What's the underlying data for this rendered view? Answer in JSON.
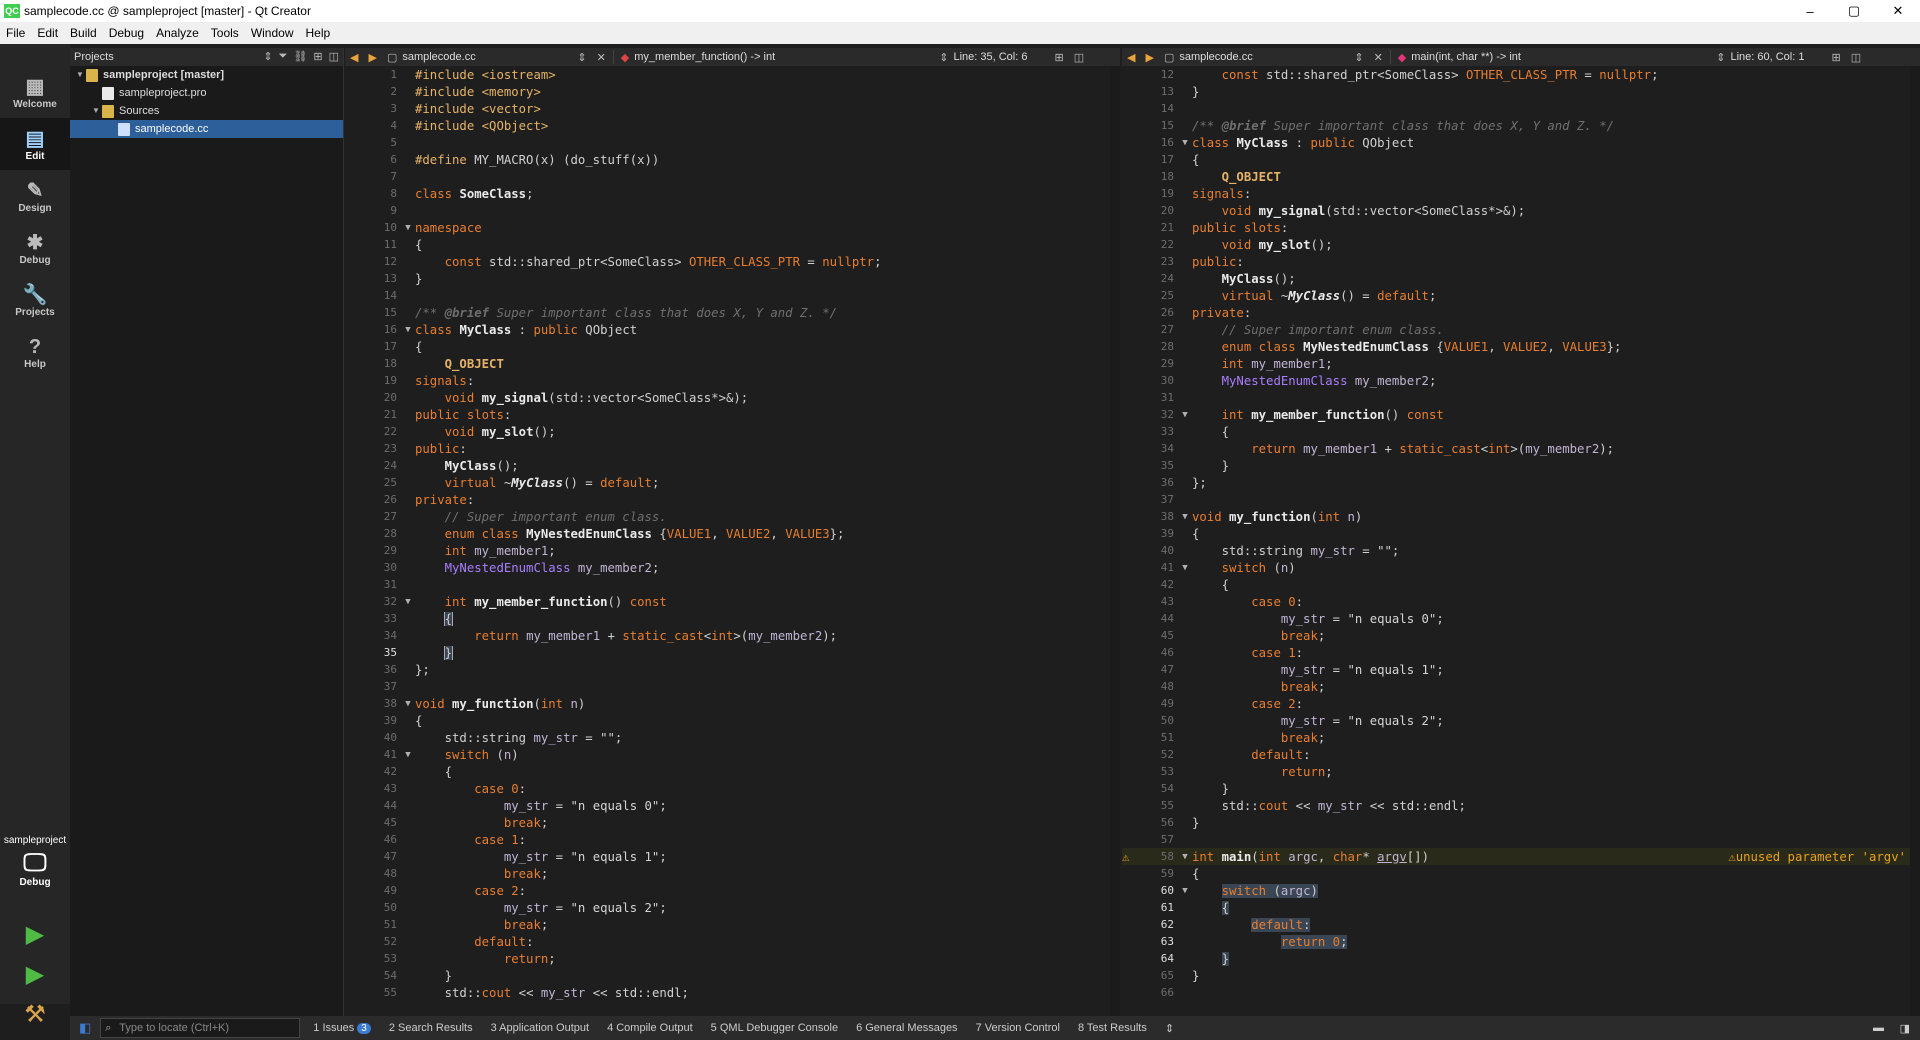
{
  "window": {
    "title": "samplecode.cc @ sampleproject [master] - Qt Creator",
    "min": "–",
    "max": "▢",
    "close": "✕",
    "logo": "QC"
  },
  "menu": [
    "File",
    "Edit",
    "Build",
    "Debug",
    "Analyze",
    "Tools",
    "Window",
    "Help"
  ],
  "modes": [
    {
      "label": "Welcome",
      "icon": "▦"
    },
    {
      "label": "Edit",
      "icon": "▤"
    },
    {
      "label": "Design",
      "icon": "✎"
    },
    {
      "label": "Debug",
      "icon": "✱"
    },
    {
      "label": "Projects",
      "icon": "🔧"
    },
    {
      "label": "Help",
      "icon": "?"
    }
  ],
  "kit": {
    "project": "sampleproject",
    "mode": "Debug"
  },
  "projects_pane": {
    "title": "Projects",
    "tree": [
      {
        "label": "sampleproject [master]",
        "level": 0,
        "arrow": "▼",
        "icon": "folder",
        "bold": true
      },
      {
        "label": "sampleproject.pro",
        "level": 1,
        "arrow": "",
        "icon": "file"
      },
      {
        "label": "Sources",
        "level": 1,
        "arrow": "▼",
        "icon": "folder"
      },
      {
        "label": "samplecode.cc",
        "level": 2,
        "arrow": "",
        "icon": "cc",
        "selected": true
      }
    ]
  },
  "editor_left": {
    "file": "samplecode.cc",
    "symbol": "my_member_function() -> int",
    "position": "Line: 35, Col: 6"
  },
  "editor_right": {
    "file": "samplecode.cc",
    "symbol": "main(int, char **) -> int",
    "position": "Line: 60, Col: 1",
    "warning": "unused parameter 'argv'"
  },
  "bottom": {
    "locator_placeholder": "Type to locate (Ctrl+K)",
    "tabs": [
      "1  Issues",
      "2  Search Results",
      "3  Application Output",
      "4  Compile Output",
      "5  QML Debugger Console",
      "6  General Messages",
      "7  Version Control",
      "8  Test Results"
    ],
    "issues_count": "3"
  },
  "code_left_lines": 55,
  "code_right_start": 12,
  "code_right_end": 66
}
